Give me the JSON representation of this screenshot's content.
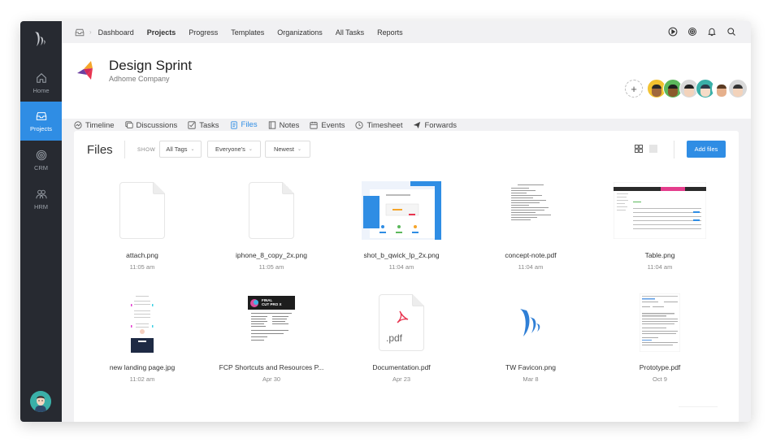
{
  "topnav": {
    "items": [
      {
        "label": "Dashboard",
        "bold": false
      },
      {
        "label": "Projects",
        "bold": true
      },
      {
        "label": "Progress",
        "bold": false
      },
      {
        "label": "Templates",
        "bold": false
      },
      {
        "label": "Organizations",
        "bold": false
      },
      {
        "label": "All Tasks",
        "bold": false
      },
      {
        "label": "Reports",
        "bold": false
      }
    ],
    "right_icons": [
      "play-circle-icon",
      "settings-icon",
      "bell-icon",
      "search-icon"
    ]
  },
  "sidebar": {
    "items": [
      {
        "label": "Home",
        "icon": "home-icon",
        "active": false
      },
      {
        "label": "Projects",
        "icon": "inbox-icon",
        "active": true
      },
      {
        "label": "CRM",
        "icon": "crm-icon",
        "active": false
      },
      {
        "label": "HRM",
        "icon": "users-icon",
        "active": false
      }
    ]
  },
  "project": {
    "title": "Design Sprint",
    "company": "Adhome Company",
    "add_member_label": "+"
  },
  "tabs": [
    {
      "label": "Timeline",
      "icon": "timeline-icon",
      "active": false
    },
    {
      "label": "Discussions",
      "icon": "discussions-icon",
      "active": false
    },
    {
      "label": "Tasks",
      "icon": "tasks-icon",
      "active": false
    },
    {
      "label": "Files",
      "icon": "files-icon",
      "active": true
    },
    {
      "label": "Notes",
      "icon": "notes-icon",
      "active": false
    },
    {
      "label": "Events",
      "icon": "calendar-icon",
      "active": false
    },
    {
      "label": "Timesheet",
      "icon": "clock-icon",
      "active": false
    },
    {
      "label": "Forwards",
      "icon": "send-icon",
      "active": false
    }
  ],
  "files_panel": {
    "title": "Files",
    "show_label": "SHOW",
    "filters": {
      "tags": "All Tags",
      "owner": "Everyone's",
      "sort": "Newest"
    },
    "add_files_label": "Add files",
    "files": [
      {
        "name": "attach.png",
        "date": "11:05 am",
        "thumb": "blank"
      },
      {
        "name": "iphone_8_copy_2x.png",
        "date": "11:05 am",
        "thumb": "blank"
      },
      {
        "name": "shot_b_qwick_lp_2x.png",
        "date": "11:04 am",
        "thumb": "screenshot"
      },
      {
        "name": "concept-note.pdf",
        "date": "11:04 am",
        "thumb": "document"
      },
      {
        "name": "Table.png",
        "date": "11:04 am",
        "thumb": "table"
      },
      {
        "name": "new landing page.jpg",
        "date": "11:02 am",
        "thumb": "landing"
      },
      {
        "name": "FCP Shortcuts and Resources P...",
        "date": "Apr 30",
        "thumb": "fcp"
      },
      {
        "name": "Documentation.pdf",
        "date": "Apr 23",
        "thumb": "pdf"
      },
      {
        "name": "TW Favicon.png",
        "date": "Mar 8",
        "thumb": "favicon"
      },
      {
        "name": "Prototype.pdf",
        "date": "Oct 9",
        "thumb": "document2"
      }
    ],
    "pdf_ext_label": ".pdf",
    "fcp_banner_text": "FINAL CUT PRO X"
  },
  "colors": {
    "accent": "#2f8de4",
    "sidebar_bg": "#272a31",
    "page_bg": "#f1f1f3"
  }
}
